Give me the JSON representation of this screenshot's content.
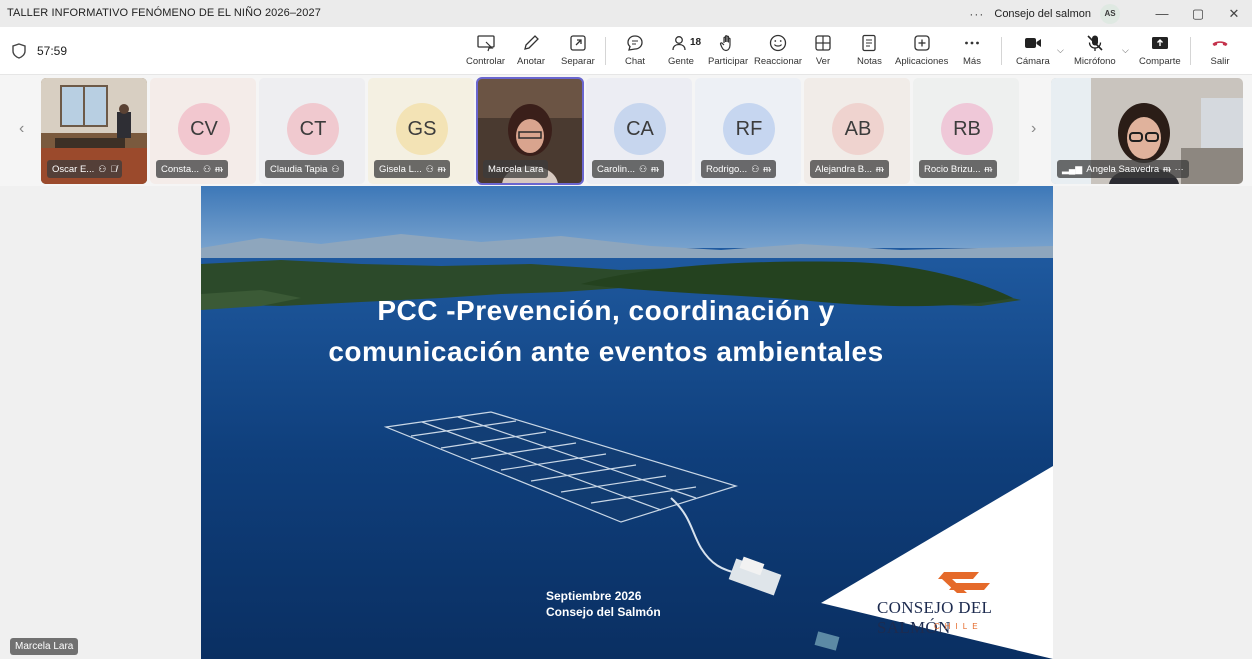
{
  "window": {
    "title": "TALLER INFORMATIVO FENÓMENO DE EL NIÑO 2026–2027",
    "more": "···",
    "org": "Consejo del salmon",
    "avatar": "AS",
    "minimize": "—",
    "restore": "▢",
    "close": "✕"
  },
  "meeting": {
    "timer": "57:59"
  },
  "toolbar": {
    "people_count": "18",
    "items": [
      {
        "label": "Controlar",
        "icon": "control-icon"
      },
      {
        "label": "Anotar",
        "icon": "pen-icon"
      },
      {
        "label": "Separar",
        "icon": "popout-icon"
      },
      {
        "label": "Chat",
        "icon": "chat-icon"
      },
      {
        "label": "Gente",
        "icon": "people-icon"
      },
      {
        "label": "Participar",
        "icon": "hand-icon"
      },
      {
        "label": "Reaccionar",
        "icon": "emoji-icon"
      },
      {
        "label": "Ver",
        "icon": "grid-icon"
      },
      {
        "label": "Notas",
        "icon": "notes-icon"
      },
      {
        "label": "Aplicaciones",
        "icon": "plus-icon"
      },
      {
        "label": "Más",
        "icon": "more-icon"
      },
      {
        "label": "Cámara",
        "icon": "camera-icon"
      },
      {
        "label": "Micrófono",
        "icon": "mic-off-icon"
      },
      {
        "label": "Comparte",
        "icon": "share-icon"
      },
      {
        "label": "Salir",
        "icon": "hangup-icon"
      }
    ]
  },
  "participants": [
    {
      "name": "Oscar E...",
      "type": "video"
    },
    {
      "name": "Consta...",
      "initials": "CV",
      "color": "#f2c7cf"
    },
    {
      "name": "Claudia Tapia",
      "initials": "CT",
      "color": "#f0c9cf"
    },
    {
      "name": "Gisela L...",
      "initials": "GS",
      "color": "#f3e3b5"
    },
    {
      "name": "Marcela Lara",
      "type": "video"
    },
    {
      "name": "Carolin...",
      "initials": "CA",
      "color": "#c7d6ee"
    },
    {
      "name": "Rodrigo...",
      "initials": "RF",
      "color": "#c6d6f0"
    },
    {
      "name": "Alejandra B...",
      "initials": "AB",
      "color": "#efd3cf"
    },
    {
      "name": "Rocio Brizu...",
      "initials": "RB",
      "color": "#efc8d8"
    },
    {
      "name": "Angela Saavedra",
      "type": "video"
    }
  ],
  "slide": {
    "title_line1": "PCC -Prevención, coordinación y",
    "title_line2": "comunicación ante eventos ambientales",
    "date": "Septiembre 2026",
    "org": "Consejo del Salmón",
    "logo_text": "CONSEJO DEL SALMÓN",
    "logo_sub": "CHILE"
  },
  "speaker_label": "Marcela Lara",
  "colors": {
    "accent": "#6a66cf",
    "hangup": "#c4314b",
    "logo_orange": "#e56a2a",
    "logo_navy": "#1d2b4f"
  }
}
